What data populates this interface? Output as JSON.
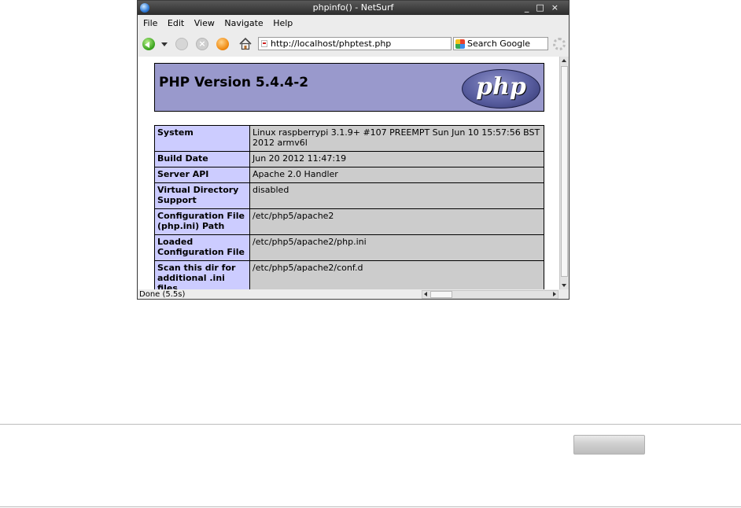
{
  "window": {
    "title": "phpinfo() - NetSurf",
    "controls": {
      "minimize": "_",
      "maximize": "□",
      "close": "×"
    }
  },
  "menu": {
    "items": [
      {
        "label": "File"
      },
      {
        "label": "Edit"
      },
      {
        "label": "View"
      },
      {
        "label": "Navigate"
      },
      {
        "label": "Help"
      }
    ]
  },
  "toolbar": {
    "icons": [
      "back-icon",
      "history-dropdown-icon",
      "forward-icon",
      "stop-icon",
      "reload-icon",
      "home-icon"
    ],
    "url": "http://localhost/phptest.php",
    "search_placeholder": "Search Google"
  },
  "page": {
    "header_title": "PHP Version 5.4.4-2",
    "logo_text": "php",
    "rows": [
      {
        "name": "System",
        "value": "Linux raspberrypi 3.1.9+ #107 PREEMPT Sun Jun 10 15:57:56 BST 2012 armv6l"
      },
      {
        "name": "Build Date",
        "value": "Jun 20 2012 11:47:19"
      },
      {
        "name": "Server API",
        "value": "Apache 2.0 Handler"
      },
      {
        "name": "Virtual Directory Support",
        "value": "disabled"
      },
      {
        "name": "Configuration File (php.ini) Path",
        "value": "/etc/php5/apache2"
      },
      {
        "name": "Loaded Configuration File",
        "value": "/etc/php5/apache2/php.ini"
      },
      {
        "name": "Scan this dir for additional .ini files",
        "value": "/etc/php5/apache2/conf.d"
      }
    ]
  },
  "status": {
    "text": "Done (5.5s)"
  },
  "colors": {
    "header_bg": "#9999cc",
    "name_cell_bg": "#ccccff",
    "value_cell_bg": "#cccccc"
  }
}
